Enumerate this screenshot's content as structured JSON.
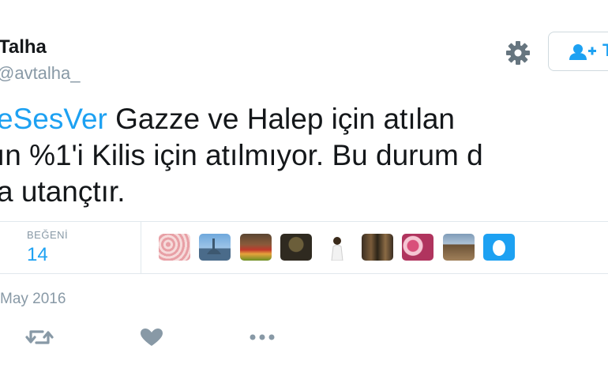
{
  "user": {
    "name": "Talha",
    "handle": "@avtalha_"
  },
  "follow_button": {
    "label": "T"
  },
  "tweet": {
    "hashtag": "eSesVer",
    "line1_rest": " Gazze ve Halep için atılan",
    "line2": "ın %1'i Kilis için atılmıyor. Bu durum d",
    "line3": "a utançtır."
  },
  "stats": {
    "likes_label": "BEĞENİ",
    "likes_count": "14"
  },
  "likers": [
    {
      "alt": "floral pattern avatar"
    },
    {
      "alt": "mosque skyline avatar"
    },
    {
      "alt": "market crowd avatar"
    },
    {
      "alt": "dark portrait avatar"
    },
    {
      "alt": "woman in white avatar"
    },
    {
      "alt": "street scene avatar"
    },
    {
      "alt": "pink pattern avatar"
    },
    {
      "alt": "building avatar"
    },
    {
      "alt": "default egg avatar"
    }
  ],
  "timestamp": "May 2016",
  "colors": {
    "accent": "#1da1f2",
    "muted": "#8899a6",
    "text": "#14171a",
    "border": "#e1e8ed"
  },
  "icons": [
    "gear-icon",
    "follow-user-icon",
    "retweet-icon",
    "like-icon",
    "more-icon"
  ]
}
